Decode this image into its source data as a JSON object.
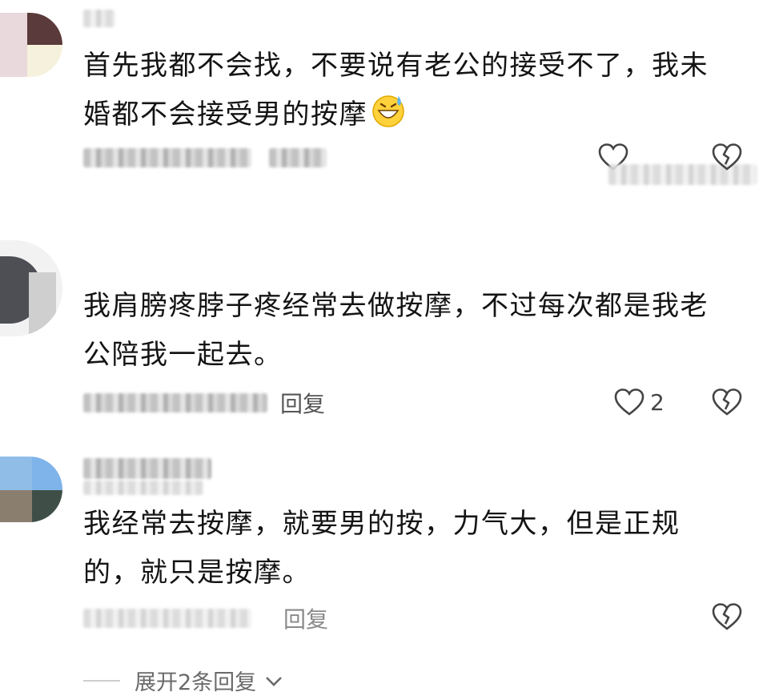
{
  "comments": [
    {
      "text": "首先我都不会找，不要说有老公的接受不了，我未婚都不会接受男的按摩",
      "emoji": "grinning-sweat-face",
      "has_like": true,
      "has_dislike": true
    },
    {
      "text": "我肩膀疼脖子疼经常去做按摩，不过每次都是我老公陪我一起去。",
      "reply_label": "回复",
      "like_count": "2",
      "has_dislike": true
    },
    {
      "text": "我经常去按摩，就要男的按，力气大，但是正规的，就只是按摩。",
      "reply_label": "回复",
      "has_dislike": true
    }
  ],
  "expand_label": "展开2条回复",
  "icons": {
    "like": "heart-outline-icon",
    "dislike": "broken-heart-icon",
    "expand": "chevron-down-icon"
  },
  "colors": {
    "text": "#141414",
    "meta": "#7a7a7a",
    "icon": "#444444"
  }
}
